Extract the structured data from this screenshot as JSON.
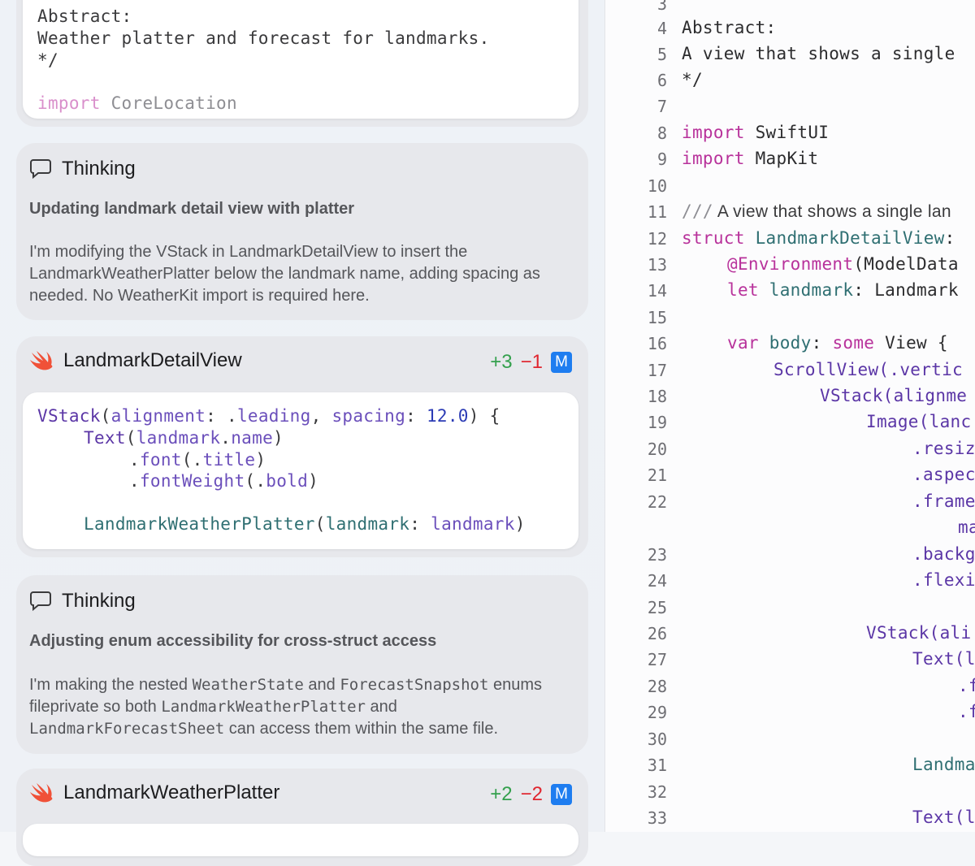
{
  "top_code": {
    "lines": [
      {
        "plain": "Abstract:"
      },
      {
        "plain": "Weather platter and forecast for landmarks."
      },
      {
        "plain": "*/"
      },
      {
        "kw": "import",
        "rest": " CoreLocation"
      }
    ]
  },
  "thinking1": {
    "label": "Thinking",
    "title": "Updating landmark detail view with platter",
    "body": "I'm modifying the VStack in LandmarkDetailView to insert the LandmarkWeatherPlatter below the landmark name, adding spacing as needed. No WeatherKit import is required here."
  },
  "file1": {
    "name": "LandmarkDetailView",
    "added": "+3",
    "removed": "−1",
    "badge": "M",
    "code": {
      "l1_a": "VStack",
      "l1_b": "(",
      "l1_c": "alignment",
      "l1_d": ": .",
      "l1_e": "leading",
      "l1_f": ", ",
      "l1_g": "spacing",
      "l1_h": ": ",
      "l1_i": "12.0",
      "l1_j": ") {",
      "l2_a": "Text",
      "l2_b": "(",
      "l2_c": "landmark",
      "l2_d": ".",
      "l2_e": "name",
      "l2_f": ")",
      "l3_a": ".",
      "l3_b": "font",
      "l3_c": "(.",
      "l3_d": "title",
      "l3_e": ")",
      "l4_a": ".",
      "l4_b": "fontWeight",
      "l4_c": "(.",
      "l4_d": "bold",
      "l4_e": ")",
      "l5_a": "LandmarkWeatherPlatter",
      "l5_b": "(",
      "l5_c": "landmark",
      "l5_d": ": ",
      "l5_e": "landmark",
      "l5_f": ")"
    }
  },
  "thinking2": {
    "label": "Thinking",
    "title": "Adjusting enum accessibility for cross-struct access",
    "body_1": "I'm making the nested ",
    "body_m1": "WeatherState",
    "body_2": " and ",
    "body_m2": "ForecastSnapshot",
    "body_3": " enums fileprivate so both ",
    "body_m3": "LandmarkWeatherPlatter",
    "body_4": " and ",
    "body_m4": "LandmarkForecastSheet",
    "body_5": " can access them within the same file."
  },
  "file2": {
    "name": "LandmarkWeatherPlatter",
    "added": "+2",
    "removed": "−2",
    "badge": "M"
  },
  "editor": {
    "line_numbers": [
      "3",
      "4",
      "5",
      "6",
      "7",
      "8",
      "9",
      "10",
      "11",
      "12",
      "13",
      "14",
      "15",
      "16",
      "17",
      "18",
      "19",
      "20",
      "21",
      "22",
      "23",
      "24",
      "25",
      "26",
      "27",
      "28",
      "29",
      "30",
      "31",
      "32",
      "33"
    ],
    "l4": "Abstract:",
    "l5": "A view that shows a single",
    "l6": "*/",
    "l8_kw": "import",
    "l8_rest": " SwiftUI",
    "l9_kw": "import",
    "l9_rest": " MapKit",
    "l11_cm": "///",
    "l11_text": " A view that shows a single lan",
    "l12_kw": "struct",
    "l12_ty": " LandmarkDetailView",
    "l12_rest": ":",
    "l13_at": "@Environment",
    "l13_rest": "(ModelData",
    "l14_kw": "let",
    "l14_ty": " landmark",
    "l14_rest": ": Landmark",
    "l16_kw": "var",
    "l16_ty": " body",
    "l16_rest": ": ",
    "l16_kw2": "some",
    "l16_rest2": " View {",
    "l17": "ScrollView(.vertic",
    "l18": "VStack(alignme",
    "l19": "Image(lanc",
    "l20": ".resiz",
    "l21": ".aspec",
    "l22": ".frame",
    "l22b": "ma",
    "l23": ".backg",
    "l24": ".flexi",
    "l26": "VStack(ali",
    "l27": "Text(l",
    "l28": ".f",
    "l29": ".f",
    "l31": "Landma",
    "l33": "Text(l"
  }
}
